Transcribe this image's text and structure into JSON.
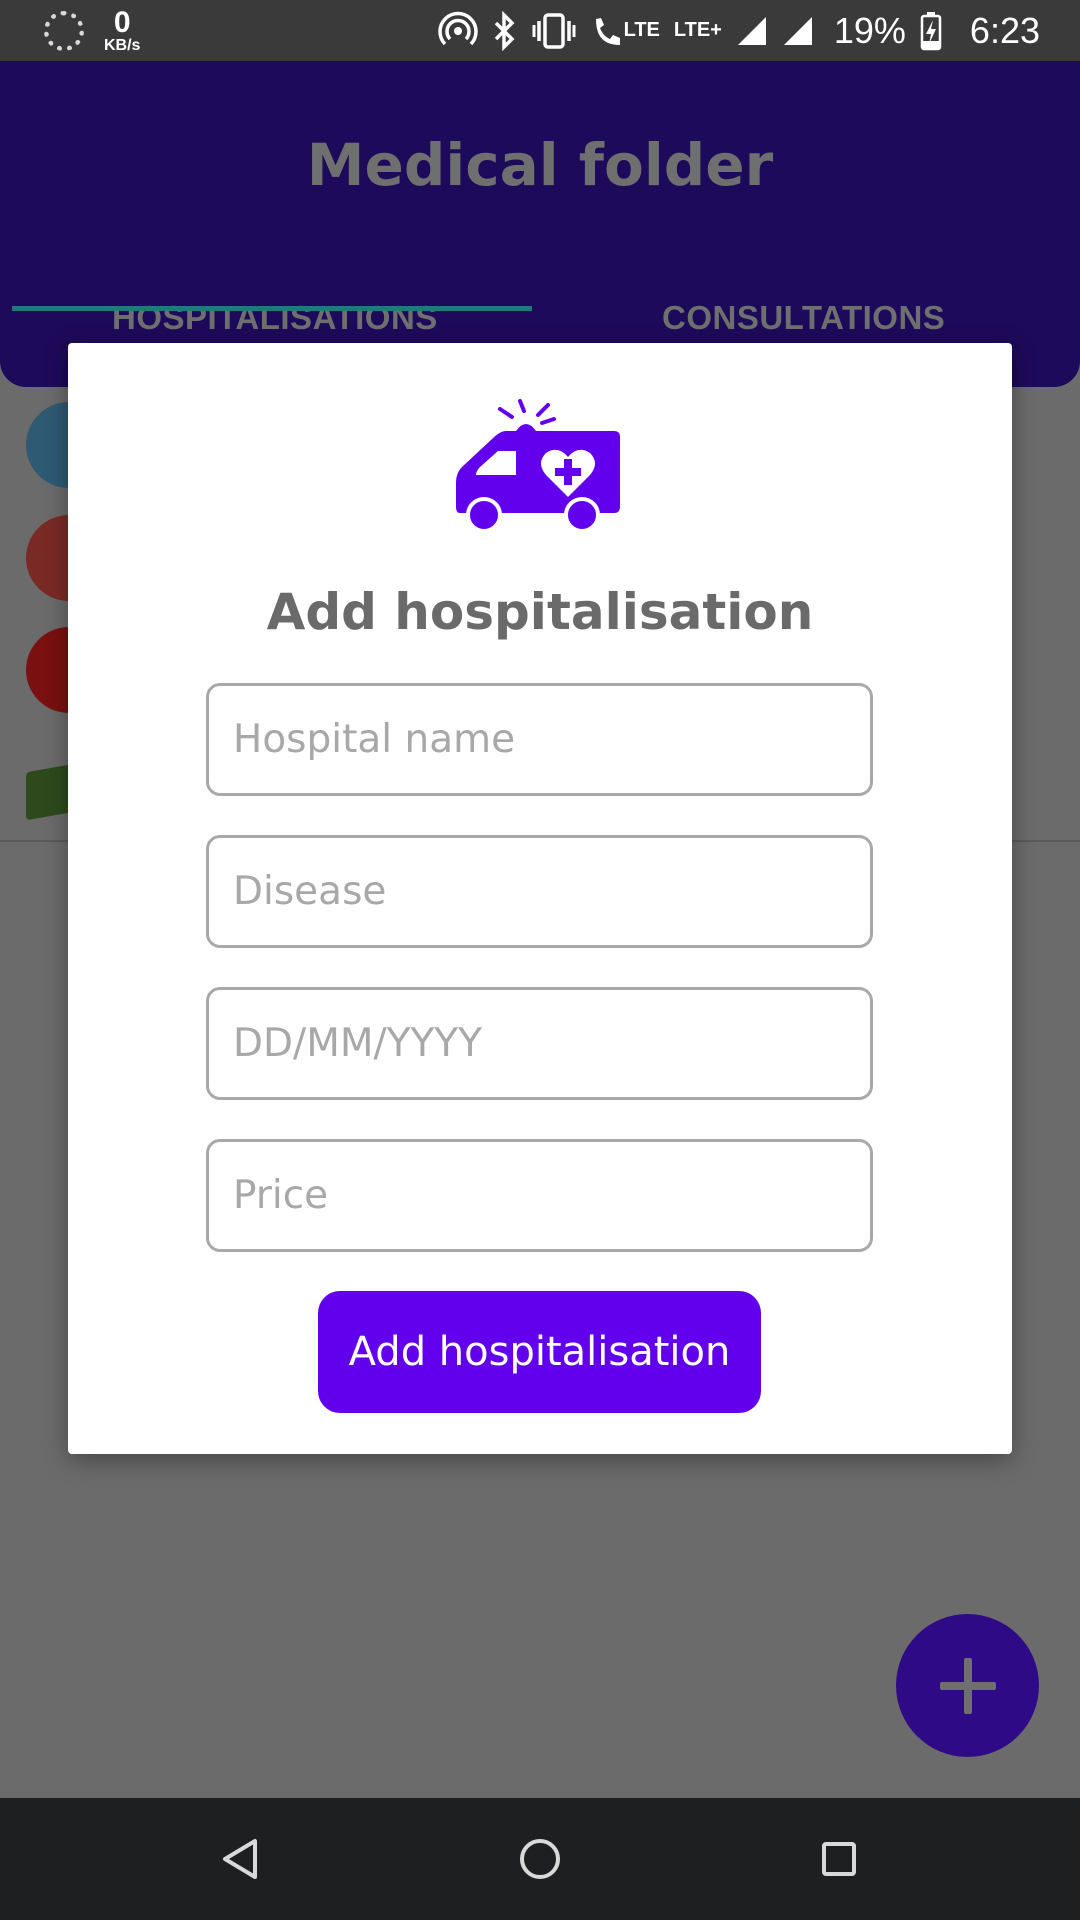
{
  "status_bar": {
    "network_speed": "0",
    "network_unit": "KB/s",
    "lte_label": "LTE",
    "lte_plus_label": "LTE+",
    "battery_percent": "19%",
    "time": "6:23"
  },
  "app_bar": {
    "title": "Medical folder",
    "tabs": [
      {
        "label": "HOSPITALISATIONS",
        "selected": true
      },
      {
        "label": "CONSULTATIONS",
        "selected": false
      }
    ]
  },
  "dialog": {
    "title": "Add hospitalisation",
    "icon": "ambulance-heart-icon",
    "fields": [
      {
        "placeholder": "Hospital name",
        "value": ""
      },
      {
        "placeholder": "Disease",
        "value": ""
      },
      {
        "placeholder": "DD/MM/YYYY",
        "value": ""
      },
      {
        "placeholder": "Price",
        "value": ""
      }
    ],
    "submit_label": "Add hospitalisation"
  },
  "fab": {
    "icon": "plus-icon"
  },
  "nav_bar": {
    "icons": [
      "back-icon",
      "home-icon",
      "recents-icon"
    ]
  },
  "colors": {
    "accent": "#6200ee",
    "app_bar": "#1e0a5a",
    "fab": "#2f0a87",
    "tab_indicator": "#1f7b76"
  }
}
